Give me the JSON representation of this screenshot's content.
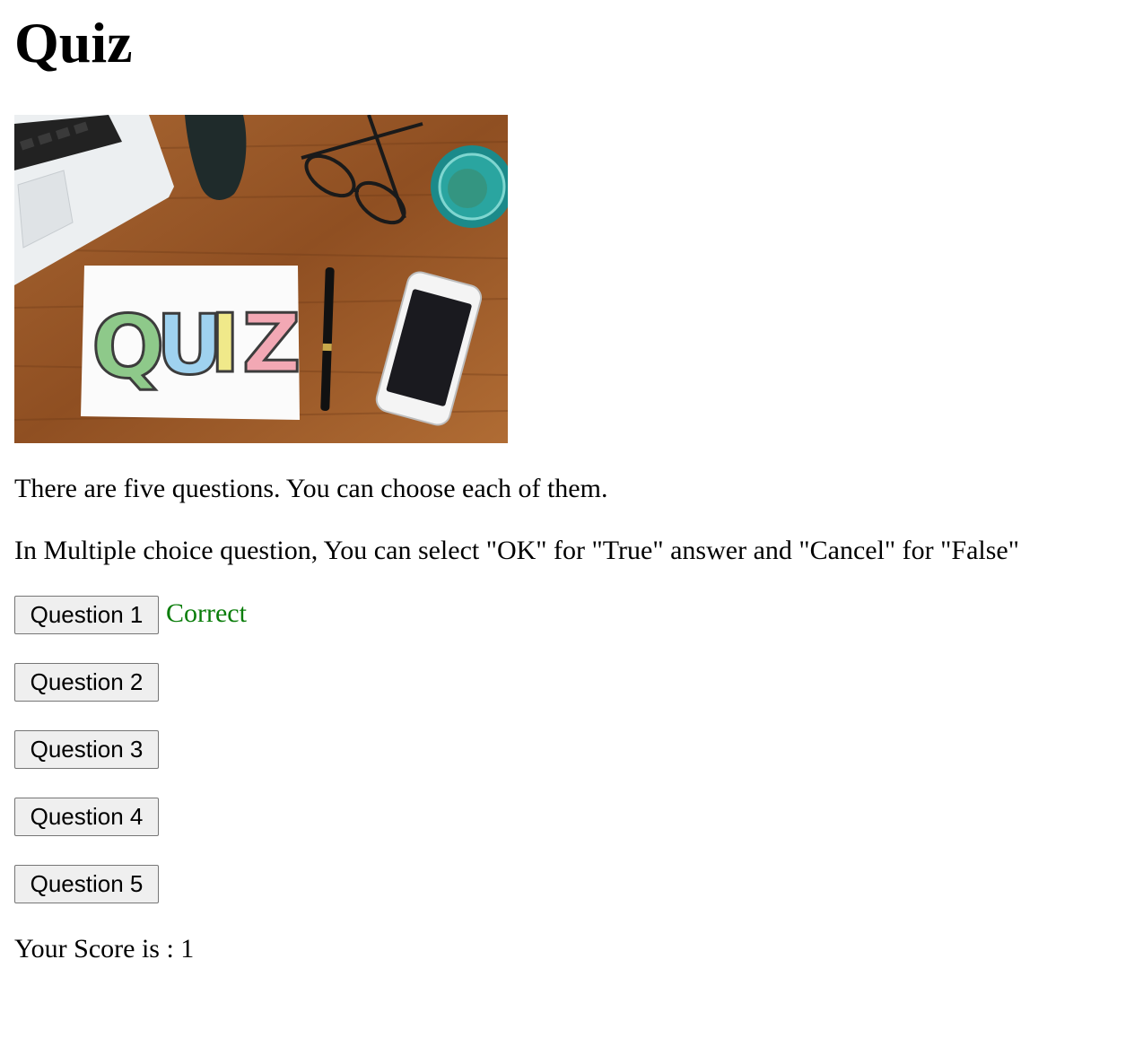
{
  "title": "Quiz",
  "hero_image": {
    "quiz_word": "QUIZ",
    "letter_colors": [
      "#8ec98a",
      "#9fd2ef",
      "#f0e98a",
      "#f2a8b4"
    ],
    "desk_color": "#9a5a2c"
  },
  "intro": "There are five questions. You can choose each of them.",
  "instructions": "In Multiple choice question, You can select \"OK\" for \"True\" answer and \"Cancel\" for \"False\"",
  "questions": [
    {
      "label": "Question 1",
      "result": "Correct",
      "result_color": "#0a7d0a"
    },
    {
      "label": "Question 2",
      "result": ""
    },
    {
      "label": "Question 3",
      "result": ""
    },
    {
      "label": "Question 4",
      "result": ""
    },
    {
      "label": "Question 5",
      "result": ""
    }
  ],
  "score_text": "Your Score is : 1"
}
